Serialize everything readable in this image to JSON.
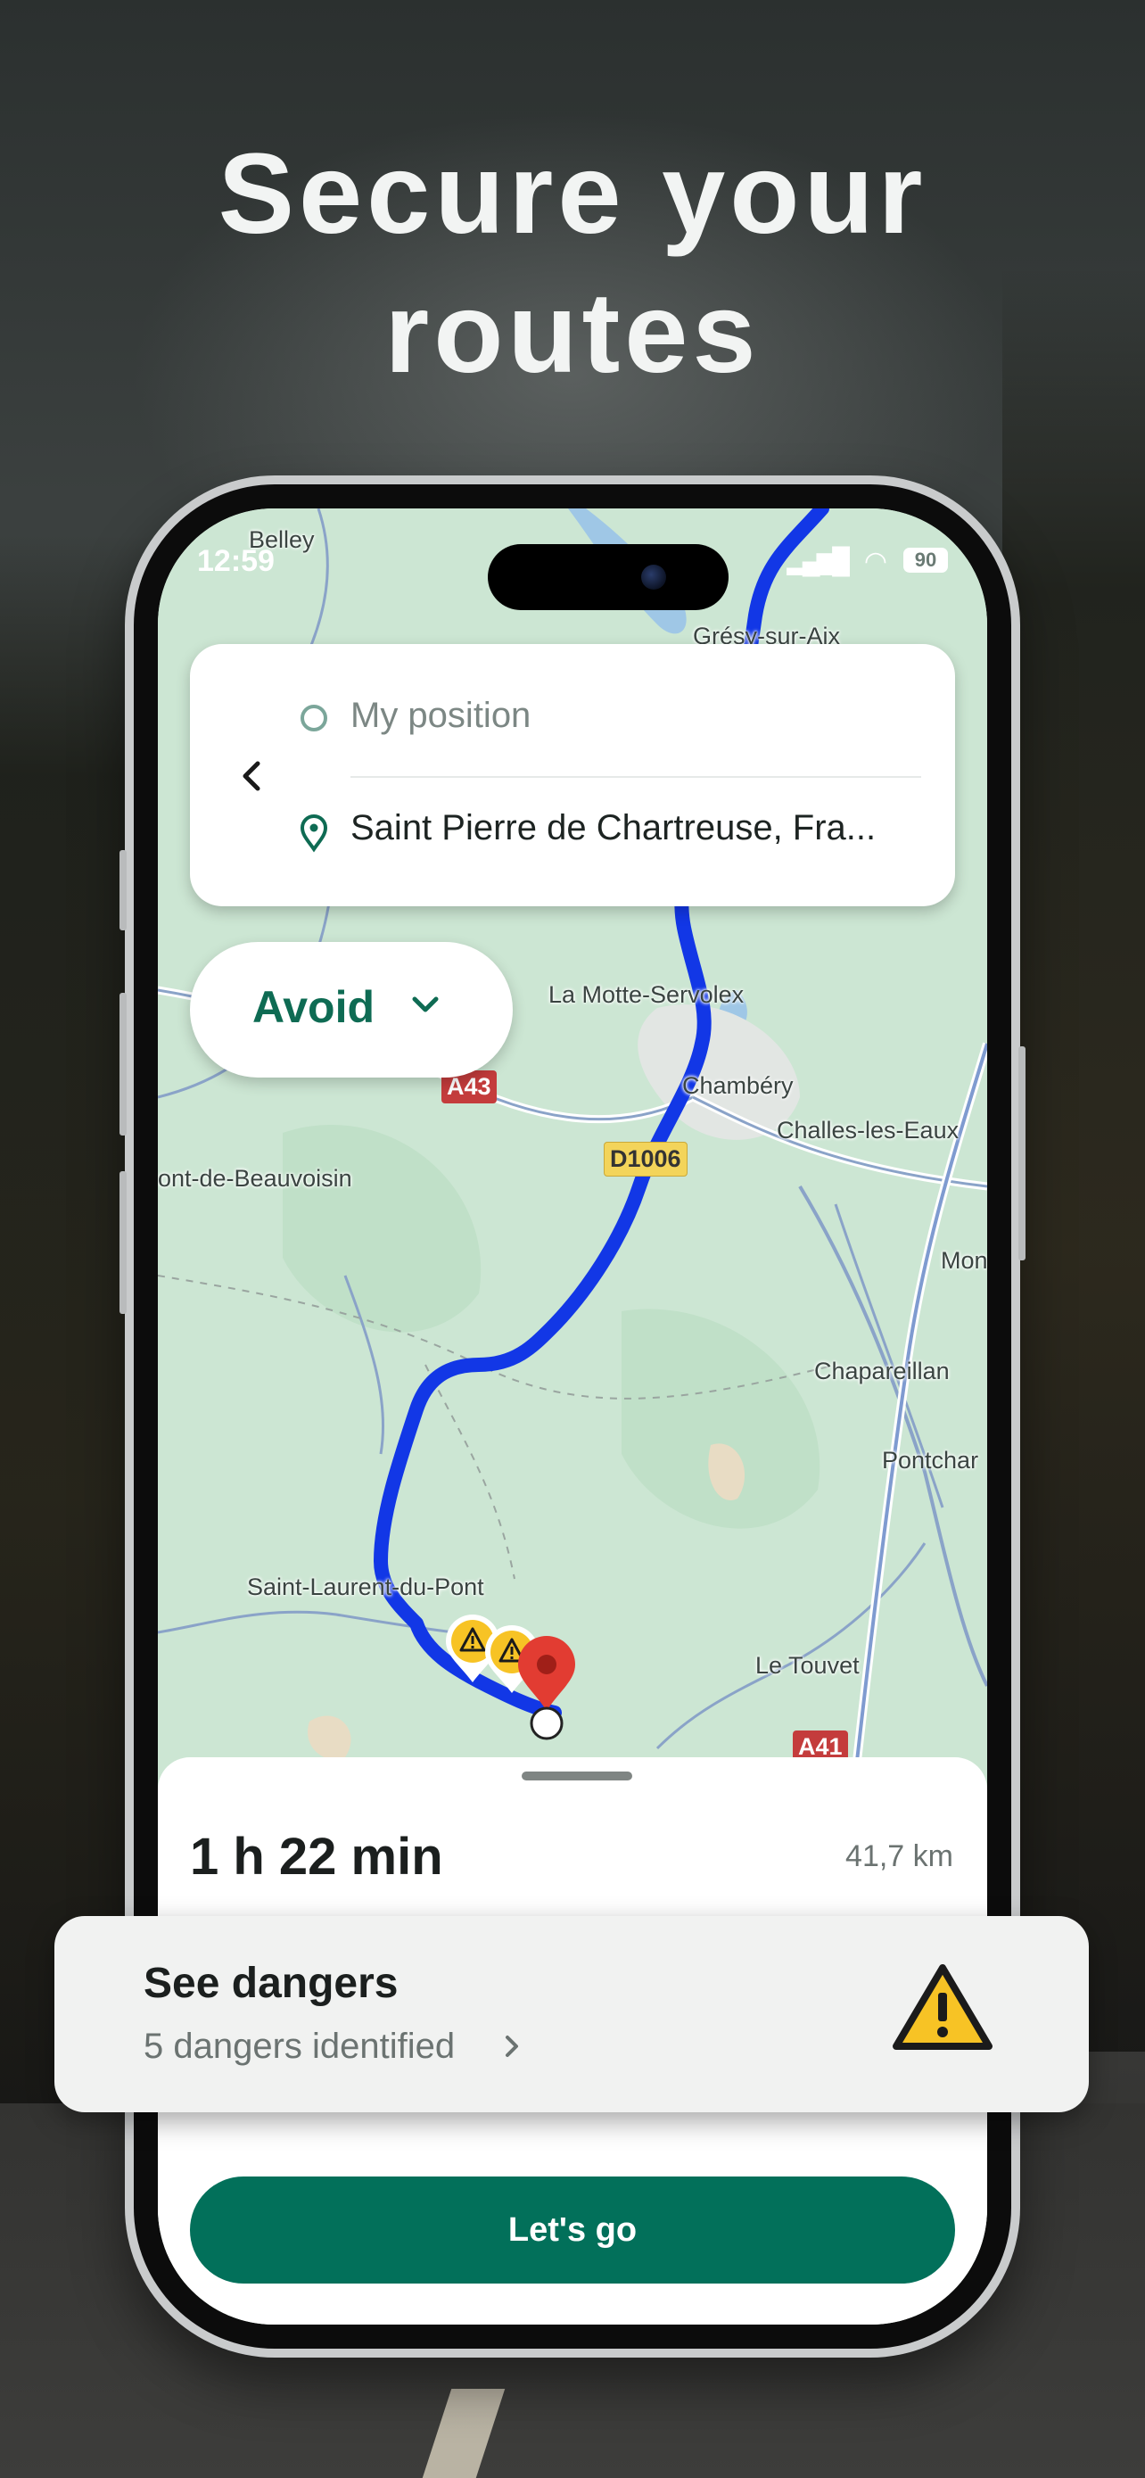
{
  "headline": {
    "line1": "Secure your",
    "line2": "routes"
  },
  "status": {
    "time": "12:59",
    "battery": "90"
  },
  "search": {
    "origin": "My position",
    "destination": "Saint Pierre de Chartreuse, Fra..."
  },
  "avoid": {
    "label": "Avoid"
  },
  "map": {
    "labels": {
      "belley": "Belley",
      "gresy": "Grésy-sur-Aix",
      "la_motte": "La Motte-Servolex",
      "chambery": "Chambéry",
      "challes": "Challes-les-Eaux",
      "pont_beauvoisin": "ont-de-Beauvoisin",
      "mon": "Mon",
      "chapareillan": "Chapareillan",
      "pontcharra": "Pontchar",
      "saint_laurent": "Saint-Laurent-du-Pont",
      "le_touvet": "Le Touvet"
    },
    "shields": {
      "a43": "A43",
      "d1006": "D1006",
      "a41": "A41"
    }
  },
  "route": {
    "duration": "1 h 22 min",
    "distance": "41,7 km"
  },
  "dangers": {
    "title": "See dangers",
    "subtitle": "5 dangers identified"
  },
  "actions": {
    "go": "Let's go"
  },
  "colors": {
    "brand": "#02705A",
    "route": "#1237E6",
    "warning": "#F7C325"
  }
}
